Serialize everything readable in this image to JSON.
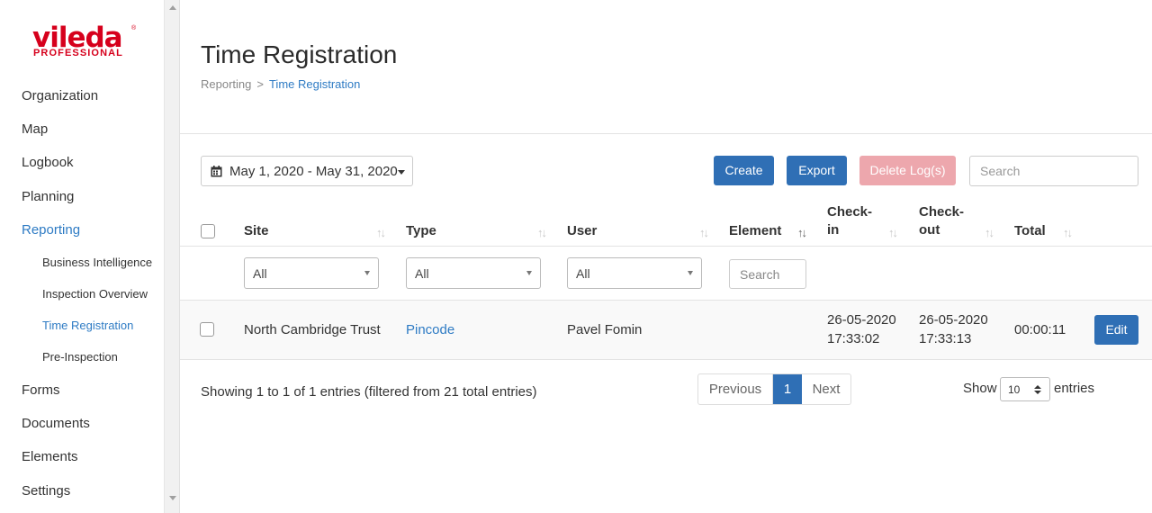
{
  "brand": {
    "name": "vileda",
    "sub": "PROFESSIONAL",
    "reg": "®"
  },
  "sidebar": {
    "items": [
      {
        "label": "Organization"
      },
      {
        "label": "Map"
      },
      {
        "label": "Logbook"
      },
      {
        "label": "Planning"
      },
      {
        "label": "Reporting",
        "active": true
      },
      {
        "label": "Forms"
      },
      {
        "label": "Documents"
      },
      {
        "label": "Elements"
      },
      {
        "label": "Settings"
      }
    ],
    "sub_items": [
      {
        "label": "Business Intelligence"
      },
      {
        "label": "Inspection Overview"
      },
      {
        "label": "Time Registration",
        "active": true
      },
      {
        "label": "Pre-Inspection"
      }
    ]
  },
  "header": {
    "title": "Time Registration",
    "breadcrumb": {
      "parent": "Reporting",
      "separator": ">",
      "current": "Time Registration"
    }
  },
  "toolbar": {
    "date_range": "May 1, 2020 - May 31, 2020",
    "create_label": "Create",
    "export_label": "Export",
    "delete_label": "Delete Log(s)",
    "search_placeholder": "Search"
  },
  "table": {
    "headers": {
      "site": "Site",
      "type": "Type",
      "user": "User",
      "element": "Element",
      "checkin_1": "Check-",
      "checkin_2": "in",
      "checkout_1": "Check-",
      "checkout_2": "out",
      "total": "Total"
    },
    "filters": {
      "site": "All",
      "type": "All",
      "user": "All",
      "element_placeholder": "Search"
    },
    "rows": [
      {
        "site": "North Cambridge Trust",
        "type": "Pincode",
        "user": "Pavel Fomin",
        "element": "",
        "checkin_date": "26-05-2020",
        "checkin_time": "17:33:02",
        "checkout_date": "26-05-2020",
        "checkout_time": "17:33:13",
        "total": "00:00:11",
        "edit_label": "Edit"
      }
    ]
  },
  "footer": {
    "info": "Showing 1 to 1 of 1 entries (filtered from 21 total entries)",
    "pager": {
      "previous": "Previous",
      "current": "1",
      "next": "Next"
    },
    "show_label": "Show",
    "page_size": "10",
    "entries_label": "entries"
  },
  "colors": {
    "accent": "#2e7bc4",
    "primary_button": "#2f6fb5",
    "danger_disabled": "#eda7ad",
    "brand_red": "#d6001c"
  }
}
